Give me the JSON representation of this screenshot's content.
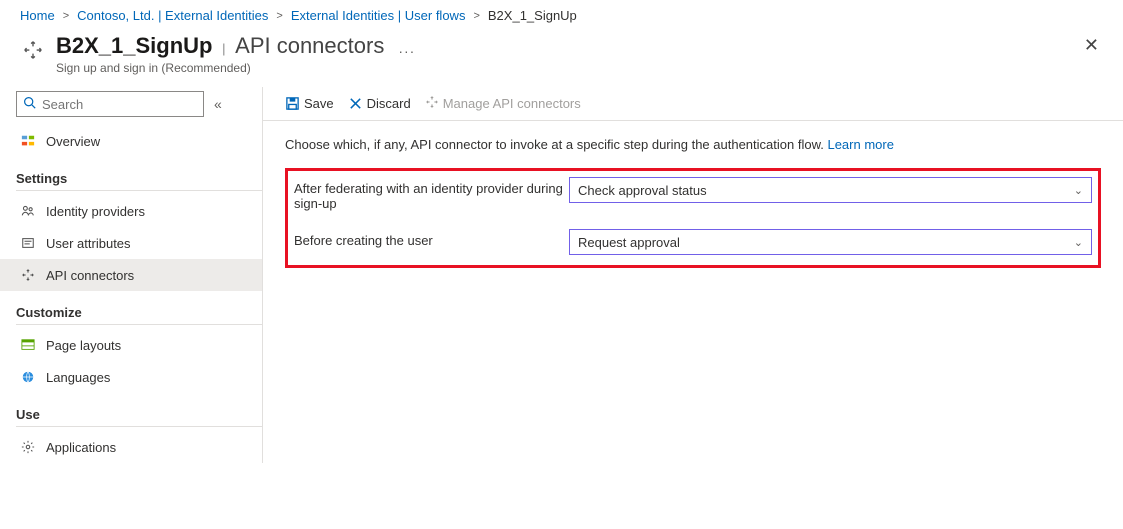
{
  "breadcrumb": {
    "items": [
      {
        "label": "Home"
      },
      {
        "label": "Contoso, Ltd. | External Identities"
      },
      {
        "label": "External Identities | User flows"
      },
      {
        "label": "B2X_1_SignUp"
      }
    ]
  },
  "header": {
    "title": "B2X_1_SignUp",
    "subtitle": "API connectors",
    "subline": "Sign up and sign in (Recommended)"
  },
  "search": {
    "placeholder": "Search"
  },
  "sidebar": {
    "top": {
      "overview": "Overview"
    },
    "sections": [
      {
        "title": "Settings",
        "items": [
          {
            "label": "Identity providers"
          },
          {
            "label": "User attributes"
          },
          {
            "label": "API connectors"
          }
        ]
      },
      {
        "title": "Customize",
        "items": [
          {
            "label": "Page layouts"
          },
          {
            "label": "Languages"
          }
        ]
      },
      {
        "title": "Use",
        "items": [
          {
            "label": "Applications"
          }
        ]
      }
    ]
  },
  "toolbar": {
    "save": "Save",
    "discard": "Discard",
    "manage": "Manage API connectors"
  },
  "content": {
    "desc": "Choose which, if any, API connector to invoke at a specific step during the authentication flow. ",
    "learn": "Learn more",
    "rows": [
      {
        "label": "After federating with an identity provider during sign-up",
        "value": "Check approval status"
      },
      {
        "label": "Before creating the user",
        "value": "Request approval"
      }
    ]
  }
}
